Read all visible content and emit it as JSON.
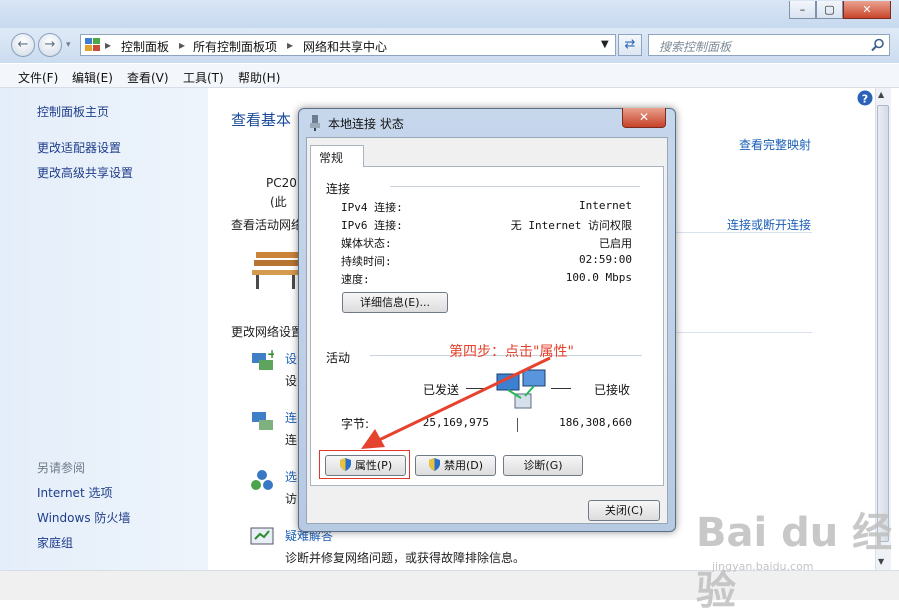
{
  "window": {
    "faint_title_1": "",
    "faint_title_2": "",
    "controls": {
      "minimize": "–",
      "maximize": "▢",
      "close": "✕"
    }
  },
  "address_bar": {
    "breadcrumbs": [
      "控制面板",
      "所有控制面板项",
      "网络和共享中心"
    ],
    "search_placeholder": "搜索控制面板"
  },
  "menu": [
    "文件(F)",
    "编辑(E)",
    "查看(V)",
    "工具(T)",
    "帮助(H)"
  ],
  "left_pane": {
    "links": [
      "控制面板主页",
      "更改适配器设置",
      "更改高级共享设置"
    ],
    "see_also_title": "另请参阅",
    "see_also": [
      "Internet 选项",
      "Windows 防火墙",
      "家庭组"
    ]
  },
  "main": {
    "title": "查看基本",
    "view_full_map": "查看完整映射",
    "pc_name": "PC201",
    "pc_sub": "(此",
    "active_networks": "查看活动网络",
    "connect_disconnect": "连接或断开连接",
    "change_settings": "更改网络设置",
    "tasks": [
      {
        "title": "设",
        "desc": "设"
      },
      {
        "title": "连",
        "desc": "连"
      },
      {
        "title": "选",
        "desc": "访"
      },
      {
        "title": "疑难解答",
        "desc": "诊断并修复网络问题，或获得故障排除信息。"
      }
    ]
  },
  "dialog": {
    "title": "本地连接 状态",
    "close_glyph": "✕",
    "tab": "常规",
    "connection_group": "连接",
    "fields": [
      {
        "label": "IPv4 连接:",
        "value": "Internet"
      },
      {
        "label": "IPv6 连接:",
        "value": "无 Internet 访问权限"
      },
      {
        "label": "媒体状态:",
        "value": "已启用"
      },
      {
        "label": "持续时间:",
        "value": "02:59:00"
      },
      {
        "label": "速度:",
        "value": "100.0 Mbps"
      }
    ],
    "details_button": "详细信息(E)...",
    "activity_group": "活动",
    "sent_label": "已发送",
    "received_label": "已接收",
    "bytes_label": "字节:",
    "bytes_sent": "25,169,975",
    "bytes_received": "186,308,660",
    "properties_button": "属性(P)",
    "disable_button": "禁用(D)",
    "diagnose_button": "诊断(G)",
    "close_button": "关闭(C)"
  },
  "annotation": "第四步：点击\"属性\"",
  "watermark": {
    "main": "Bai du 经验",
    "sub": "jingyan.baidu.com"
  },
  "colors": {
    "link": "#1f3d8a",
    "title": "#1b4c9b",
    "annotation": "#e5432d"
  }
}
